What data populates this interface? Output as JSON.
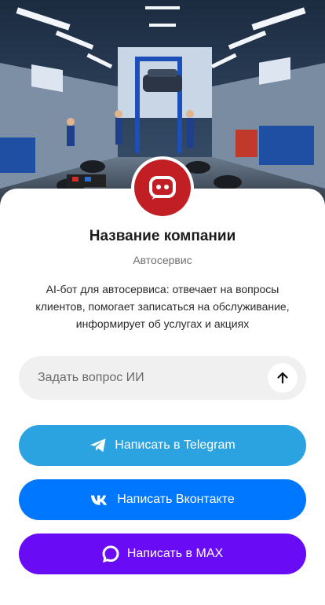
{
  "company": {
    "name": "Название компании",
    "type": "Автосервис",
    "description": "AI-бот для автосервиса: отвечает на вопросы клиентов, помогает записаться на обслуживание, информирует об услугах и акциях"
  },
  "ask": {
    "placeholder": "Задать вопрос ИИ",
    "value": ""
  },
  "buttons": {
    "telegram": {
      "label": "Написать в Telegram",
      "icon": "telegram-icon",
      "color": "#2ca3e1"
    },
    "vk": {
      "label": "Написать Вконтакте",
      "icon": "vk-icon",
      "color": "#0077ff"
    },
    "max": {
      "label": "Написать в MAX",
      "icon": "max-icon",
      "color": "#6a0bf5"
    }
  },
  "colors": {
    "avatar_bg": "#c21f24",
    "ask_bg": "#f0f0f0"
  }
}
